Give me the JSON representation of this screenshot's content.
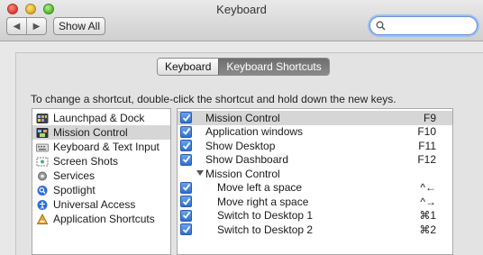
{
  "window": {
    "title": "Keyboard"
  },
  "toolbar": {
    "back_label": "◀",
    "forward_label": "▶",
    "show_all_label": "Show All",
    "search_placeholder": ""
  },
  "tabs": [
    {
      "label": "Keyboard",
      "selected": false
    },
    {
      "label": "Keyboard Shortcuts",
      "selected": true
    }
  ],
  "instructions": "To change a shortcut, double-click the shortcut and hold down the new keys.",
  "categories": [
    {
      "label": "Launchpad & Dock",
      "icon": "launchpad-icon",
      "selected": false
    },
    {
      "label": "Mission Control",
      "icon": "mission-control-icon",
      "selected": true
    },
    {
      "label": "Keyboard & Text Input",
      "icon": "keyboard-icon",
      "selected": false
    },
    {
      "label": "Screen Shots",
      "icon": "screenshot-icon",
      "selected": false
    },
    {
      "label": "Services",
      "icon": "gear-icon",
      "selected": false
    },
    {
      "label": "Spotlight",
      "icon": "spotlight-icon",
      "selected": false
    },
    {
      "label": "Universal Access",
      "icon": "universal-access-icon",
      "selected": false
    },
    {
      "label": "Application Shortcuts",
      "icon": "app-shortcuts-icon",
      "selected": false
    }
  ],
  "shortcuts": [
    {
      "name": "Mission Control",
      "keys": "F9",
      "checked": true,
      "selected": true,
      "level": 0
    },
    {
      "name": "Application windows",
      "keys": "F10",
      "checked": true,
      "selected": false,
      "level": 0
    },
    {
      "name": "Show Desktop",
      "keys": "F11",
      "checked": true,
      "selected": false,
      "level": 0
    },
    {
      "name": "Show Dashboard",
      "keys": "F12",
      "checked": true,
      "selected": false,
      "level": 0
    },
    {
      "name": "Mission Control",
      "keys": "",
      "checked": null,
      "selected": false,
      "level": "group"
    },
    {
      "name": "Move left a space",
      "keys": "^←",
      "checked": true,
      "selected": false,
      "level": 1
    },
    {
      "name": "Move right a space",
      "keys": "^→",
      "checked": true,
      "selected": false,
      "level": 1
    },
    {
      "name": "Switch to Desktop 1",
      "keys": "⌘1",
      "checked": true,
      "selected": false,
      "level": 1
    },
    {
      "name": "Switch to Desktop 2",
      "keys": "⌘2",
      "checked": true,
      "selected": false,
      "level": 1
    }
  ],
  "colors": {
    "checkbox": "#3a78d8",
    "selection": "#d6d6d6",
    "search_focus": "#9fc0ef"
  }
}
